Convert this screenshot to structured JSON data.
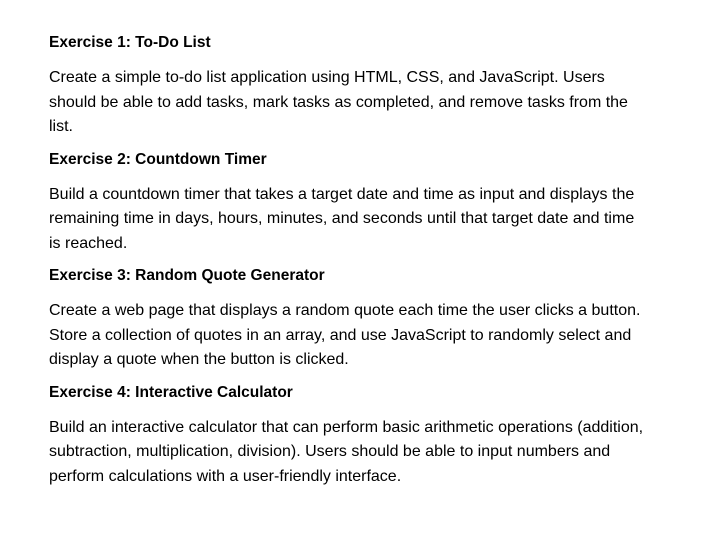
{
  "exercises": [
    {
      "title": "Exercise 1: To-Do List",
      "body": "Create a simple to-do list application using HTML, CSS, and JavaScript. Users should be able to add tasks, mark tasks as completed, and remove tasks from the list."
    },
    {
      "title": "Exercise 2: Countdown Timer",
      "body": "Build a countdown timer that takes a target date and time as input and displays the remaining time in days, hours, minutes, and seconds until that target date and time is reached."
    },
    {
      "title": "Exercise 3: Random Quote Generator",
      "body": "Create a web page that displays a random quote each time the user clicks a button. Store a collection of quotes in an array, and use JavaScript to randomly select and display a quote when the button is clicked."
    },
    {
      "title": "Exercise 4: Interactive Calculator",
      "body": "Build an interactive calculator that can perform basic arithmetic operations (addition, subtraction, multiplication, division). Users should be able to input numbers and perform calculations with a user-friendly interface."
    }
  ]
}
